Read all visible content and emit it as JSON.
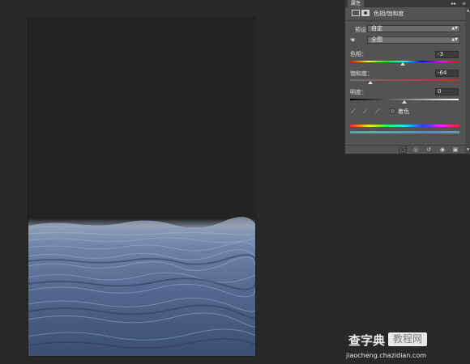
{
  "panel": {
    "tab_label": "属性",
    "collapse_glyph": "▸▸",
    "menu_glyph": "≡",
    "title": "色相/饱和度",
    "preset": {
      "label": "预设：",
      "value": "自定"
    },
    "range": {
      "value": "全图"
    },
    "hue": {
      "label": "色相：",
      "value": "-3",
      "level_percent": 49
    },
    "saturation": {
      "label": "饱和度：",
      "value": "-64",
      "level_percent": 18
    },
    "lightness": {
      "label": "明度：",
      "value": "0",
      "level_percent": 50
    },
    "colorize": {
      "label": "着色",
      "checked": false
    },
    "footer_icons": [
      "clip-to-layer-icon",
      "view-previous-icon",
      "reset-icon",
      "visibility-icon",
      "delete-icon"
    ]
  },
  "colors": {
    "app_background": "#282828",
    "document_dark": "#232323",
    "panel_background": "#535353",
    "sea_deep": "#3c4e72",
    "sea_light": "#7d92b2"
  },
  "watermark": {
    "main": "查字典",
    "badge": "教程网",
    "url": "jiaocheng.chazidian.com"
  }
}
